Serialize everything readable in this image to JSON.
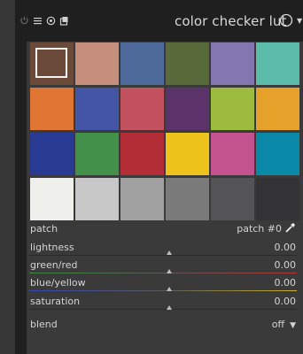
{
  "header": {
    "title": "color checker lut",
    "icons": [
      "power-icon",
      "presets-icon",
      "instance-icon",
      "reset-icon"
    ]
  },
  "patches": [
    {
      "color": "#6b4a3a",
      "selected": true
    },
    {
      "color": "#c48d7c"
    },
    {
      "color": "#4e6a9b"
    },
    {
      "color": "#586a3a"
    },
    {
      "color": "#8277b0"
    },
    {
      "color": "#5cbba8"
    },
    {
      "color": "#e07634"
    },
    {
      "color": "#4455a5"
    },
    {
      "color": "#c25160"
    },
    {
      "color": "#5c326a"
    },
    {
      "color": "#9dbb3e"
    },
    {
      "color": "#e6a12a"
    },
    {
      "color": "#283a91"
    },
    {
      "color": "#43904b"
    },
    {
      "color": "#b22d36"
    },
    {
      "color": "#edc31b"
    },
    {
      "color": "#c3538f"
    },
    {
      "color": "#0a88a7"
    },
    {
      "color": "#efefeb"
    },
    {
      "color": "#c8c8c8"
    },
    {
      "color": "#a1a1a1"
    },
    {
      "color": "#7a7a7a"
    },
    {
      "color": "#545456"
    },
    {
      "color": "#333335"
    }
  ],
  "controls": {
    "patch": {
      "label": "patch",
      "value": "patch #0"
    },
    "lightness": {
      "label": "lightness",
      "value": "0.00"
    },
    "green_red": {
      "label": "green/red",
      "value": "0.00"
    },
    "blue_yellow": {
      "label": "blue/yellow",
      "value": "0.00"
    },
    "saturation": {
      "label": "saturation",
      "value": "0.00"
    },
    "blend": {
      "label": "blend",
      "value": "off"
    }
  },
  "slider_colors": {
    "green_red": [
      "#3d8a3d",
      "#b83535"
    ],
    "blue_yellow": [
      "#3548b0",
      "#c9b030"
    ]
  }
}
